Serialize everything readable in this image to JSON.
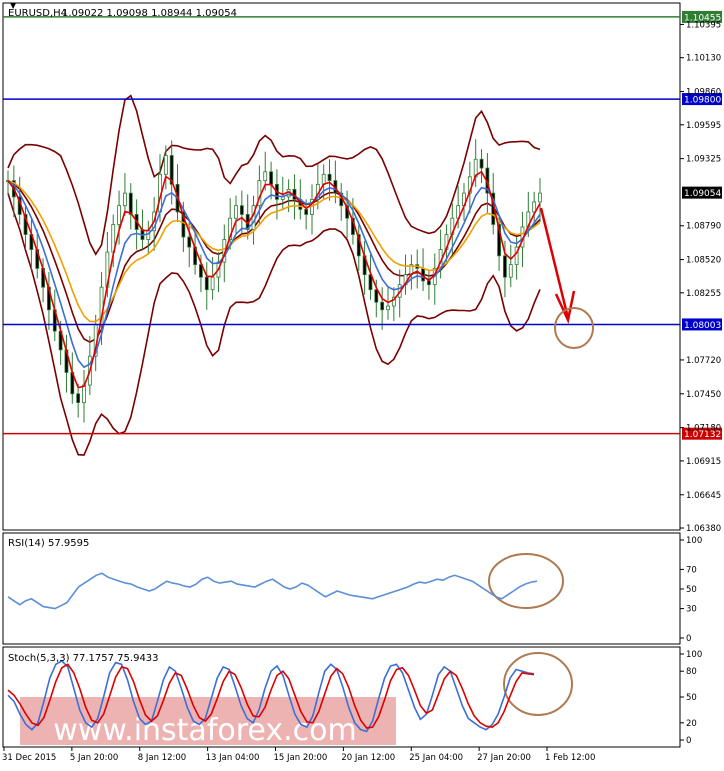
{
  "header": {
    "symbol_label": "EURUSD,H4",
    "ohlc_label": "1.09022 1.09098 1.08944 1.09054"
  },
  "rsi_panel": {
    "label": "RSI(14) 57.9595",
    "ticks": [
      "100",
      "70",
      "50",
      "30",
      "0"
    ]
  },
  "stoch_panel": {
    "label": "Stoch(5,3,3) 77.1757 75.9433",
    "ticks": [
      "100",
      "80",
      "50",
      "20",
      "0"
    ]
  },
  "watermark": "www.instaforex.com",
  "colors": {
    "price_line": "#2e7d32",
    "green_level": "#2e7d32",
    "blue_level": "#0000cc",
    "red_level": "#cc0000",
    "bands": "#7a0000",
    "ema_fast": "#e00000",
    "ema_mid": "#3a6fd8",
    "ema_slow": "#f0a000",
    "rsi": "#5b8fd6",
    "stoch_k": "#3a6fd8",
    "stoch_d": "#dd0000",
    "annotation": "#b07a50",
    "arrow": "#dd0000",
    "watermark_bg": "#e79a9a"
  },
  "chart_data": {
    "type": "candlestick",
    "title": "EURUSD,H4",
    "price_axis": {
      "ylim": [
        1.0638,
        1.1055
      ],
      "ticks": [
        "1.10395",
        "1.10130",
        "1.09860",
        "1.09595",
        "1.09325",
        "1.08790",
        "1.08520",
        "1.08255",
        "1.07720",
        "1.07450",
        "1.07180",
        "1.06915",
        "1.06645",
        "1.06380"
      ]
    },
    "x_labels": [
      "31 Dec 2015",
      "5 Jan 20:00",
      "8 Jan 12:00",
      "13 Jan 04:00",
      "15 Jan 20:00",
      "20 Jan 12:00",
      "25 Jan 04:00",
      "27 Jan 20:00",
      "1 Feb 12:00"
    ],
    "levels": [
      {
        "label": "1.10455",
        "value": 1.10455,
        "color": "green"
      },
      {
        "label": "1.09800",
        "value": 1.098,
        "color": "blue"
      },
      {
        "label": "1.09054",
        "value": 1.09054,
        "color": "current"
      },
      {
        "label": "1.08003",
        "value": 1.08003,
        "color": "blue"
      },
      {
        "label": "1.07132",
        "value": 1.07132,
        "color": "red"
      }
    ],
    "close_series": [
      1.0915,
      1.0902,
      1.0888,
      1.0872,
      1.086,
      1.0845,
      1.083,
      1.0812,
      1.0795,
      1.078,
      1.0762,
      1.0745,
      1.0738,
      1.0752,
      1.0775,
      1.08,
      1.083,
      1.0858,
      1.088,
      1.0895,
      1.0905,
      1.0888,
      1.0876,
      1.0868,
      1.0875,
      1.089,
      1.092,
      1.0935,
      1.0912,
      1.089,
      1.087,
      1.0862,
      1.0848,
      1.0838,
      1.0828,
      1.0838,
      1.085,
      1.0868,
      1.0885,
      1.0895,
      1.0888,
      1.0876,
      1.0895,
      1.0915,
      1.0922,
      1.0912,
      1.09,
      1.0902,
      1.0908,
      1.09,
      1.0892,
      1.0888,
      1.09,
      1.0912,
      1.092,
      1.0915,
      1.0905,
      1.0895,
      1.0885,
      1.0872,
      1.0855,
      1.084,
      1.0828,
      1.0818,
      1.0812,
      1.0815,
      1.0822,
      1.0832,
      1.084,
      1.0848,
      1.0845,
      1.0835,
      1.0832,
      1.0845,
      1.086,
      1.0872,
      1.0885,
      1.0895,
      1.0905,
      1.0918,
      1.0932,
      1.0925,
      1.0905,
      1.088,
      1.0855,
      1.0838,
      1.0848,
      1.0862,
      1.0878,
      1.089,
      1.0898,
      1.0905
    ],
    "rsi_series": [
      42,
      38,
      34,
      38,
      40,
      36,
      32,
      31,
      30,
      33,
      36,
      44,
      52,
      56,
      60,
      64,
      66,
      62,
      60,
      58,
      56,
      55,
      52,
      50,
      48,
      50,
      54,
      58,
      56,
      55,
      53,
      52,
      55,
      60,
      62,
      58,
      56,
      57,
      58,
      55,
      54,
      53,
      52,
      55,
      58,
      60,
      56,
      52,
      50,
      52,
      56,
      54,
      50,
      46,
      42,
      45,
      48,
      46,
      44,
      43,
      42,
      41,
      40,
      42,
      44,
      46,
      48,
      50,
      52,
      55,
      57,
      56,
      58,
      60,
      59,
      62,
      64,
      62,
      60,
      58,
      54,
      50,
      46,
      42,
      40,
      44,
      48,
      52,
      55,
      57,
      58
    ],
    "stoch_k_series": [
      52,
      45,
      30,
      18,
      12,
      20,
      45,
      72,
      88,
      92,
      85,
      60,
      35,
      20,
      15,
      25,
      50,
      78,
      90,
      88,
      70,
      45,
      25,
      18,
      22,
      45,
      70,
      85,
      80,
      60,
      38,
      22,
      18,
      25,
      48,
      72,
      85,
      82,
      62,
      40,
      25,
      20,
      35,
      60,
      80,
      86,
      75,
      52,
      30,
      18,
      15,
      28,
      55,
      80,
      88,
      82,
      62,
      38,
      20,
      12,
      10,
      22,
      48,
      72,
      86,
      88,
      78,
      58,
      38,
      24,
      30,
      52,
      76,
      85,
      80,
      60,
      40,
      25,
      20,
      15,
      12,
      18,
      30,
      50,
      72,
      82,
      80,
      78,
      77
    ],
    "stoch_d_series": [
      58,
      52,
      42,
      30,
      20,
      17,
      26,
      46,
      68,
      84,
      88,
      78,
      60,
      38,
      23,
      20,
      30,
      51,
      73,
      85,
      83,
      68,
      47,
      29,
      22,
      28,
      46,
      66,
      78,
      75,
      59,
      40,
      26,
      22,
      30,
      48,
      68,
      80,
      76,
      61,
      42,
      28,
      27,
      38,
      58,
      75,
      80,
      71,
      52,
      33,
      21,
      20,
      33,
      54,
      74,
      83,
      77,
      61,
      40,
      23,
      14,
      15,
      27,
      47,
      69,
      82,
      84,
      75,
      58,
      40,
      31,
      35,
      53,
      71,
      80,
      75,
      60,
      42,
      28,
      20,
      16,
      15,
      20,
      33,
      51,
      68,
      78,
      77,
      76
    ]
  }
}
